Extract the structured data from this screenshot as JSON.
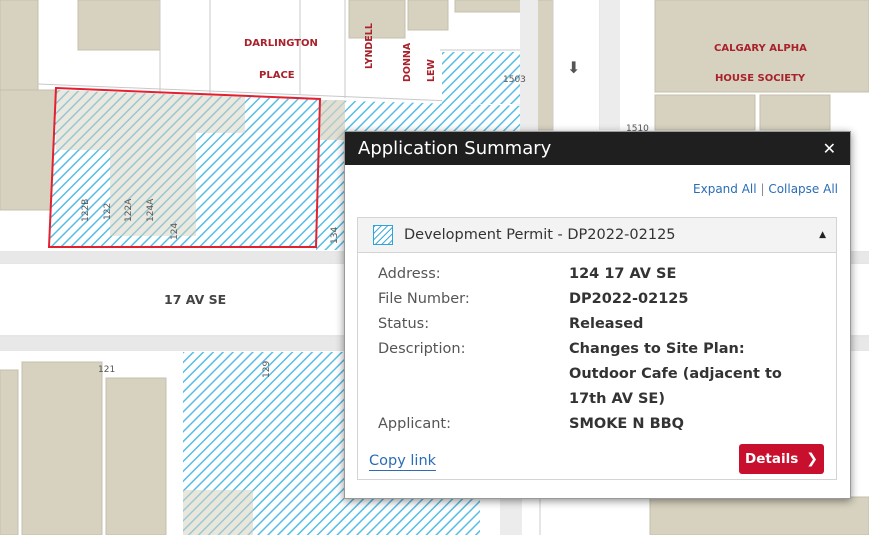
{
  "map": {
    "street_name": "17 AV SE",
    "labels": {
      "darlington_1": "DARLINGTON",
      "darlington_2": "PLACE",
      "lyndell": "LYNDELL",
      "donna": "DONNA",
      "lew": "LEW",
      "calgary_1": "CALGARY ALPHA",
      "calgary_2": "HOUSE SOCIETY"
    },
    "lot_numbers": {
      "n1503": "1503",
      "n1510": "1510",
      "n122b": "122B",
      "n122": "122",
      "n122a": "122A",
      "n124a": "124A",
      "n124": "124",
      "n134": "134",
      "n121": "121",
      "n129": "129"
    },
    "colors": {
      "hatch": "#56bde6",
      "building": "#d7d2bf",
      "road": "#ffffff",
      "selection": "#e3202f",
      "label": "#a8212b"
    }
  },
  "popup": {
    "title": "Application Summary",
    "close_icon": "close-icon",
    "expand_all": "Expand All",
    "separator": "|",
    "collapse_all": "Collapse All",
    "panel": {
      "icon": "hatched-permit-icon",
      "title": "Development Permit - DP2022-02125",
      "caret": "▲"
    },
    "fields": [
      {
        "label": "Address:",
        "value": "124 17 AV SE"
      },
      {
        "label": "File Number:",
        "value": "DP2022-02125"
      },
      {
        "label": "Status:",
        "value": "Released"
      },
      {
        "label": "Description:",
        "value": "Changes to Site Plan: Outdoor Cafe (adjacent to 17th AV SE)"
      },
      {
        "label": "Applicant:",
        "value": "SMOKE N BBQ"
      }
    ],
    "copy_link": "Copy link",
    "details_button": "Details",
    "details_chevron": "❯"
  }
}
